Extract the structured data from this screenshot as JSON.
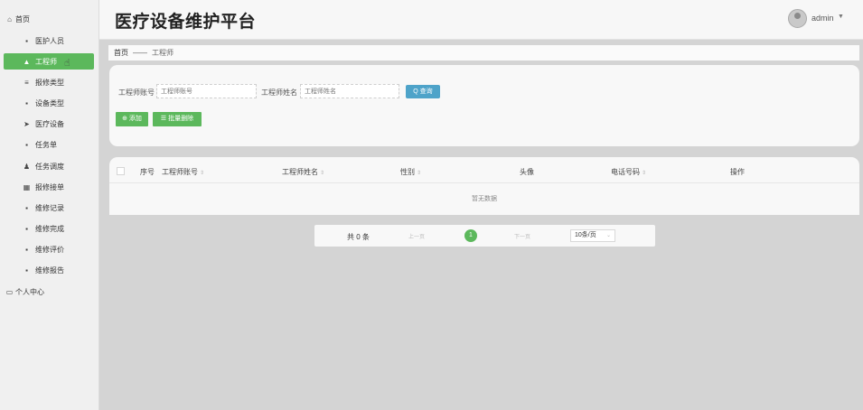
{
  "header": {
    "title": "医疗设备维护平台",
    "user": "admin",
    "caret": "▼"
  },
  "sidebar": {
    "items": [
      {
        "label": "首页",
        "icon": "⌂"
      },
      {
        "label": "医护人员",
        "icon": "▪"
      },
      {
        "label": "工程师",
        "icon": "▲"
      },
      {
        "label": "报修类型",
        "icon": "≡"
      },
      {
        "label": "设备类型",
        "icon": "▪"
      },
      {
        "label": "医疗设备",
        "icon": "➤"
      },
      {
        "label": "任务单",
        "icon": "▪"
      },
      {
        "label": "任务调度",
        "icon": "♟"
      },
      {
        "label": "报修接单",
        "icon": "▦"
      },
      {
        "label": "维修记录",
        "icon": "▪"
      },
      {
        "label": "维修完成",
        "icon": "▪"
      },
      {
        "label": "维修评价",
        "icon": "▪"
      },
      {
        "label": "维修报告",
        "icon": "▪"
      },
      {
        "label": "个人中心",
        "icon": "▭"
      }
    ]
  },
  "breadcrumb": {
    "home": "首页",
    "sep": "——",
    "current": "工程师"
  },
  "search": {
    "account_label": "工程师账号",
    "account_placeholder": "工程师账号",
    "name_label": "工程师姓名",
    "name_placeholder": "工程师姓名",
    "query_label": "Q 查询"
  },
  "actions": {
    "add_label": "⊕ 添加",
    "batch_delete_label": "☰ 批量删除"
  },
  "table": {
    "columns": [
      {
        "label": "序号",
        "sortable": false
      },
      {
        "label": "工程师账号",
        "sortable": true
      },
      {
        "label": "工程师姓名",
        "sortable": true
      },
      {
        "label": "性别",
        "sortable": true
      },
      {
        "label": "头像",
        "sortable": false
      },
      {
        "label": "电话号码",
        "sortable": true
      },
      {
        "label": "操作",
        "sortable": false
      }
    ],
    "sort_icon": "⇕",
    "empty_text": "暂无数据"
  },
  "pagination": {
    "total": "共 0 条",
    "prev": "上一页",
    "current_page": "1",
    "next": "下一页",
    "page_size": "10条/页",
    "page_size_caret": "⌄"
  }
}
